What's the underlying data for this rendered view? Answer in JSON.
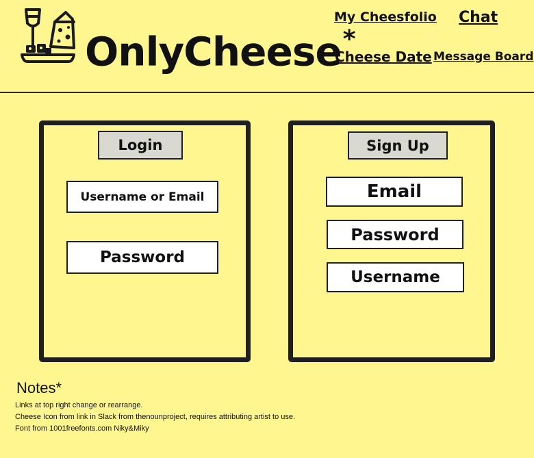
{
  "header": {
    "brand": "OnlyCheese",
    "brand_mark": "*",
    "logo_icon": "wine-and-cheese-icon"
  },
  "nav": {
    "cheesfolio": "My Cheesfolio",
    "chat": "Chat",
    "cheese_date": "Cheese Date",
    "message_board": "Message Board"
  },
  "login": {
    "title": "Login",
    "username_field": "Username or Email",
    "password_field": "Password"
  },
  "signup": {
    "title": "Sign Up",
    "email_field": "Email",
    "password_field": "Password",
    "username_field": "Username"
  },
  "notes": {
    "title": "Notes*",
    "lines": [
      "Links at top right change or rearrange.",
      "Cheese Icon from link in Slack from thenounproject, requires attributing artist to use.",
      "Font from 1001freefonts.com Niky&Miky"
    ]
  }
}
